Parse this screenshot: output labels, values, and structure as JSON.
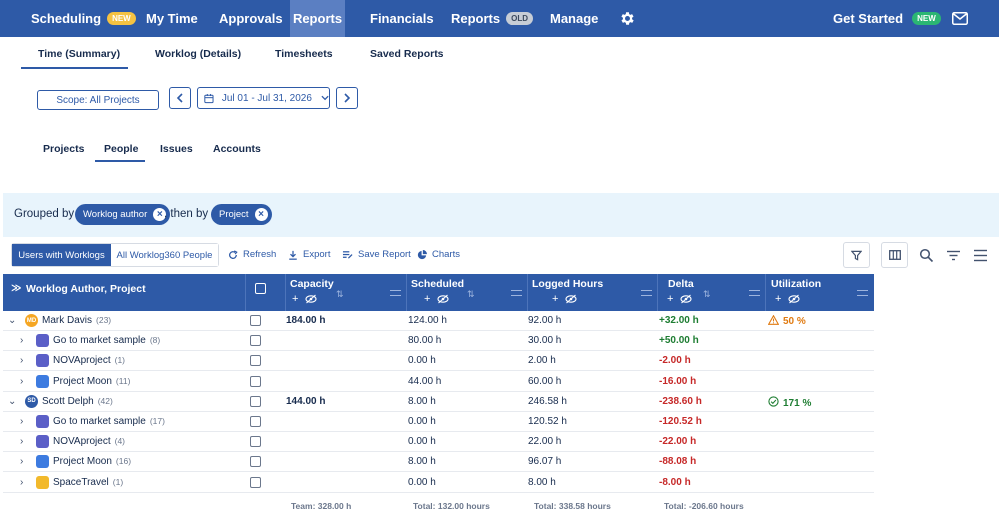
{
  "nav": {
    "items": [
      {
        "label": "Scheduling",
        "badge": "NEW"
      },
      {
        "label": "My Time"
      },
      {
        "label": "Approvals"
      },
      {
        "label": "Reports"
      },
      {
        "label": "Financials"
      },
      {
        "label": "Reports",
        "badge": "OLD"
      },
      {
        "label": "Manage"
      }
    ],
    "get_started": "Get Started",
    "get_started_badge": "NEW"
  },
  "subtabs": [
    "Time (Summary)",
    "Worklog (Details)",
    "Timesheets",
    "Saved Reports"
  ],
  "scope_label": "Scope: All Projects",
  "date_range": "Jul 01 - Jul 31, 2026",
  "view_tabs": [
    "Projects",
    "People",
    "Issues",
    "Accounts"
  ],
  "grouping": {
    "prefix": "Grouped by",
    "first": "Worklog author",
    "middle": ", then by",
    "second": "Project"
  },
  "toolbar": {
    "users_with_worklogs": "Users with Worklogs",
    "all_people": "All Worklog360 People",
    "refresh": "Refresh",
    "export": "Export",
    "save_report": "Save Report",
    "charts": "Charts"
  },
  "columns": {
    "author": "Worklog Author, Project",
    "capacity": "Capacity",
    "scheduled": "Scheduled",
    "logged": "Logged Hours",
    "delta": "Delta",
    "utilization": "Utilization"
  },
  "rows": [
    {
      "level": 0,
      "chevron": "⌄",
      "initials": "MD",
      "name": "Mark Davis",
      "count": "(23)",
      "capacity": "184.00 h",
      "scheduled": "124.00 h",
      "logged": "92.00 h",
      "delta": "+32.00 h",
      "delta_sign": "pos",
      "utilization": "50 %",
      "util_state": "warn"
    },
    {
      "level": 1,
      "chevron": "›",
      "name": "Go to market sample",
      "count": "(8)",
      "capacity": "",
      "scheduled": "80.00 h",
      "logged": "30.00 h",
      "delta": "+50.00 h",
      "delta_sign": "pos",
      "utilization": "",
      "icon_color": "#5b5fc7"
    },
    {
      "level": 1,
      "chevron": "›",
      "name": "NOVAproject",
      "count": "(1)",
      "capacity": "",
      "scheduled": "0.00 h",
      "logged": "2.00 h",
      "delta": "-2.00 h",
      "delta_sign": "neg",
      "utilization": "",
      "icon_color": "#5b5fc7"
    },
    {
      "level": 1,
      "chevron": "›",
      "name": "Project Moon",
      "count": "(11)",
      "capacity": "",
      "scheduled": "44.00 h",
      "logged": "60.00 h",
      "delta": "-16.00 h",
      "delta_sign": "neg",
      "utilization": "",
      "icon_color": "#3d7be0"
    },
    {
      "level": 0,
      "chevron": "⌄",
      "initials": "SD",
      "name": "Scott Delph",
      "count": "(42)",
      "capacity": "144.00 h",
      "scheduled": "8.00 h",
      "logged": "246.58 h",
      "delta": "-238.60 h",
      "delta_sign": "neg",
      "utilization": "171 %",
      "util_state": "ok"
    },
    {
      "level": 1,
      "chevron": "›",
      "name": "Go to market sample",
      "count": "(17)",
      "capacity": "",
      "scheduled": "0.00 h",
      "logged": "120.52 h",
      "delta": "-120.52 h",
      "delta_sign": "neg",
      "utilization": "",
      "icon_color": "#5b5fc7"
    },
    {
      "level": 1,
      "chevron": "›",
      "name": "NOVAproject",
      "count": "(4)",
      "capacity": "",
      "scheduled": "0.00 h",
      "logged": "22.00 h",
      "delta": "-22.00 h",
      "delta_sign": "neg",
      "utilization": "",
      "icon_color": "#5b5fc7"
    },
    {
      "level": 1,
      "chevron": "›",
      "name": "Project Moon",
      "count": "(16)",
      "capacity": "",
      "scheduled": "8.00 h",
      "logged": "96.07 h",
      "delta": "-88.08 h",
      "delta_sign": "neg",
      "utilization": "",
      "icon_color": "#3d7be0"
    },
    {
      "level": 1,
      "chevron": "›",
      "name": "SpaceTravel",
      "count": "(1)",
      "capacity": "",
      "scheduled": "0.00 h",
      "logged": "8.00 h",
      "delta": "-8.00 h",
      "delta_sign": "neg",
      "utilization": "",
      "icon_color": "#f2b92c"
    }
  ],
  "footer": {
    "team": "Team: 328.00 h",
    "scheduled_total": "Total: 132.00 hours",
    "logged_total": "Total: 338.58 hours",
    "delta_total": "Total: -206.60 hours"
  },
  "icons": {
    "settings": "gear-icon",
    "mail": "mail-icon",
    "filter": "filter-icon",
    "columns": "columns-icon",
    "search": "search-icon",
    "sort": "sort-lines-icon",
    "menu": "hamburger-icon"
  },
  "colors": {
    "brand": "#2e5aa7",
    "positive": "#1e7d32",
    "negative": "#c62828",
    "warning": "#e07a10"
  }
}
